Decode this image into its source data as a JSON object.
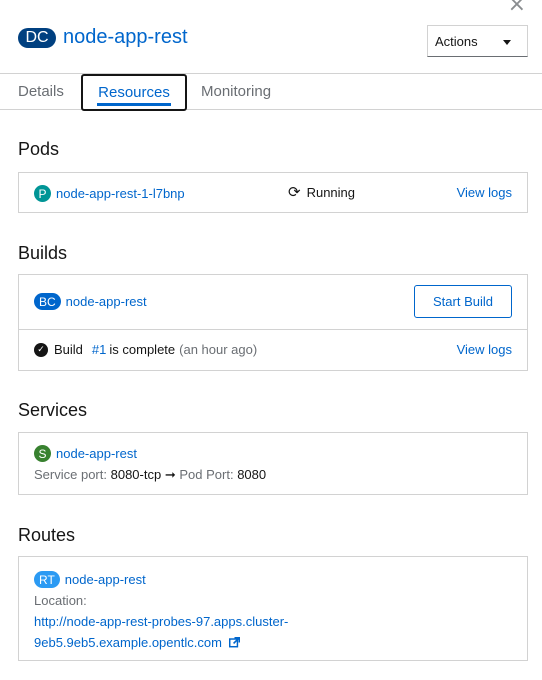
{
  "header": {
    "kind_badge": "DC",
    "app_name": "node-app-rest",
    "actions_label": "Actions",
    "close_glyph": "×"
  },
  "tabs": [
    {
      "label": "Details"
    },
    {
      "label": "Resources"
    },
    {
      "label": "Monitoring"
    }
  ],
  "pods": {
    "title": "Pods",
    "badge": "P",
    "name": "node-app-rest-1-l7bnp",
    "status": "Running",
    "view_logs": "View logs"
  },
  "builds": {
    "title": "Builds",
    "badge": "BC",
    "name": "node-app-rest",
    "start_build": "Start Build",
    "build_word": "Build",
    "build_number": "#1",
    "complete_text": "is complete",
    "time_ago": "(an hour ago)",
    "view_logs": "View logs"
  },
  "services": {
    "title": "Services",
    "badge": "S",
    "name": "node-app-rest",
    "service_port_label": "Service port:",
    "service_port": "8080-tcp",
    "arrow": "➞",
    "pod_port_label": "Pod Port:",
    "pod_port": "8080"
  },
  "routes": {
    "title": "Routes",
    "badge": "RT",
    "name": "node-app-rest",
    "location_label": "Location:",
    "url_line1": "http://node-app-rest-probes-97.apps.cluster-",
    "url_line2": "9eb5.9eb5.example.opentlc.com"
  },
  "colors": {
    "link": "#0066cc",
    "dc_badge": "#004080",
    "pod_badge": "#009596",
    "service_badge": "#38812f"
  }
}
